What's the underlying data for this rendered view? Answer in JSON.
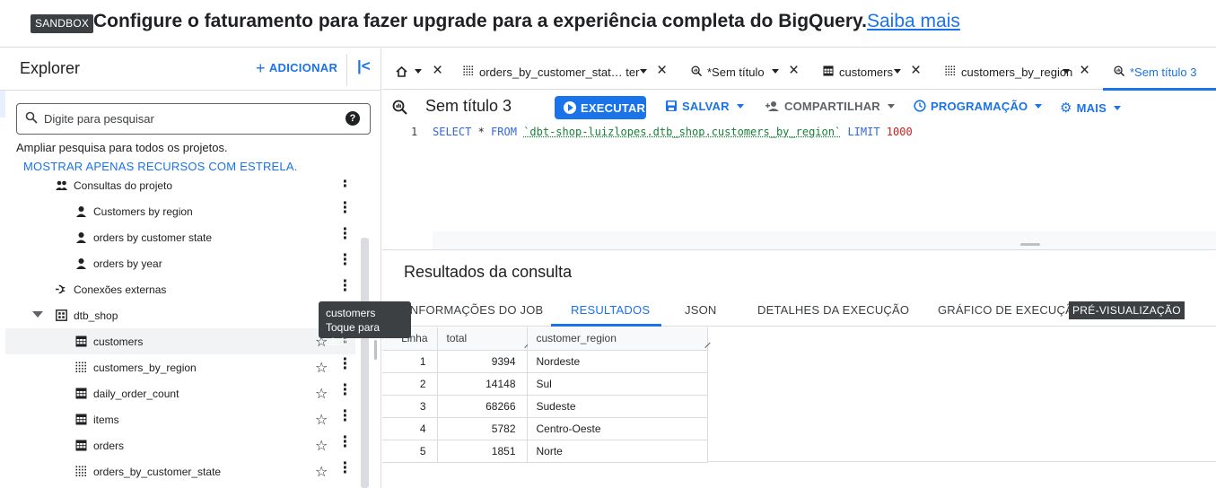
{
  "banner": {
    "badge": "SANDBOX",
    "message": "Configure o faturamento para fazer upgrade para a experiência completa do BigQuery.",
    "link": "Saiba mais"
  },
  "explorer": {
    "title": "Explorer",
    "add_label": "ADICIONAR",
    "search_placeholder": "Digite para pesquisar",
    "expand_text": "Ampliar pesquisa para todos os projetos.",
    "starred_link": "MOSTRAR APENAS RECURSOS COM ESTRELA.",
    "tree": [
      {
        "label": "Consultas do projeto",
        "icon": "people-icon",
        "indent": 2
      },
      {
        "label": "Customers by region",
        "icon": "person-icon",
        "indent": 3
      },
      {
        "label": "orders by customer state",
        "icon": "person-icon",
        "indent": 3
      },
      {
        "label": "orders by year",
        "icon": "person-icon",
        "indent": 3
      },
      {
        "label": "Conexões externas",
        "icon": "connection-icon",
        "indent": 2
      },
      {
        "label": "dtb_shop",
        "icon": "dataset-icon",
        "indent": 2
      },
      {
        "label": "customers",
        "icon": "table-icon",
        "indent": 3
      },
      {
        "label": "customers_by_region",
        "icon": "view-icon",
        "indent": 3
      },
      {
        "label": "daily_order_count",
        "icon": "table-icon",
        "indent": 3
      },
      {
        "label": "items",
        "icon": "table-icon",
        "indent": 3
      },
      {
        "label": "orders",
        "icon": "table-icon",
        "indent": 3
      },
      {
        "label": "orders_by_customer_state",
        "icon": "view-icon",
        "indent": 3
      }
    ]
  },
  "tooltip": {
    "title": "customers",
    "hint": "Toque para abrir"
  },
  "tabs": [
    {
      "label": "orders_by_customer_stat… ter",
      "icon": "view-icon"
    },
    {
      "label": "*Sem título",
      "icon": "query-icon"
    },
    {
      "label": "customers",
      "icon": "table-icon"
    },
    {
      "label": "customers_by_region",
      "icon": "view-icon"
    },
    {
      "label": "*Sem título 3",
      "icon": "query-icon"
    }
  ],
  "toolbar": {
    "query_title": "Sem título 3",
    "run": "EXECUTAR",
    "save": "SALVAR",
    "share": "COMPARTILHAR",
    "schedule": "PROGRAMAÇÃO",
    "more": "MAIS"
  },
  "editor": {
    "line_number": "1",
    "sql": {
      "select": "SELECT",
      "star": " * ",
      "from": "FROM",
      "table": "`dbt-shop-luizlopes.dtb_shop.customers_by_region`",
      "limit": "LIMIT",
      "limit_value": "1000"
    }
  },
  "results": {
    "title": "Resultados da consulta",
    "tabs": [
      "INFORMAÇÕES DO JOB",
      "RESULTADOS",
      "JSON",
      "DETALHES DA EXECUÇÃO",
      "GRÁFICO DE EXECUÇÃO"
    ],
    "preview_badge": "PRÉ-VISUALIZAÇÃO",
    "columns": [
      "Linha",
      "total",
      "customer_region"
    ],
    "rows": [
      [
        "1",
        "9394",
        "Nordeste"
      ],
      [
        "2",
        "14148",
        "Sul"
      ],
      [
        "3",
        "68266",
        "Sudeste"
      ],
      [
        "4",
        "5782",
        "Centro-Oeste"
      ],
      [
        "5",
        "1851",
        "Norte"
      ]
    ]
  }
}
